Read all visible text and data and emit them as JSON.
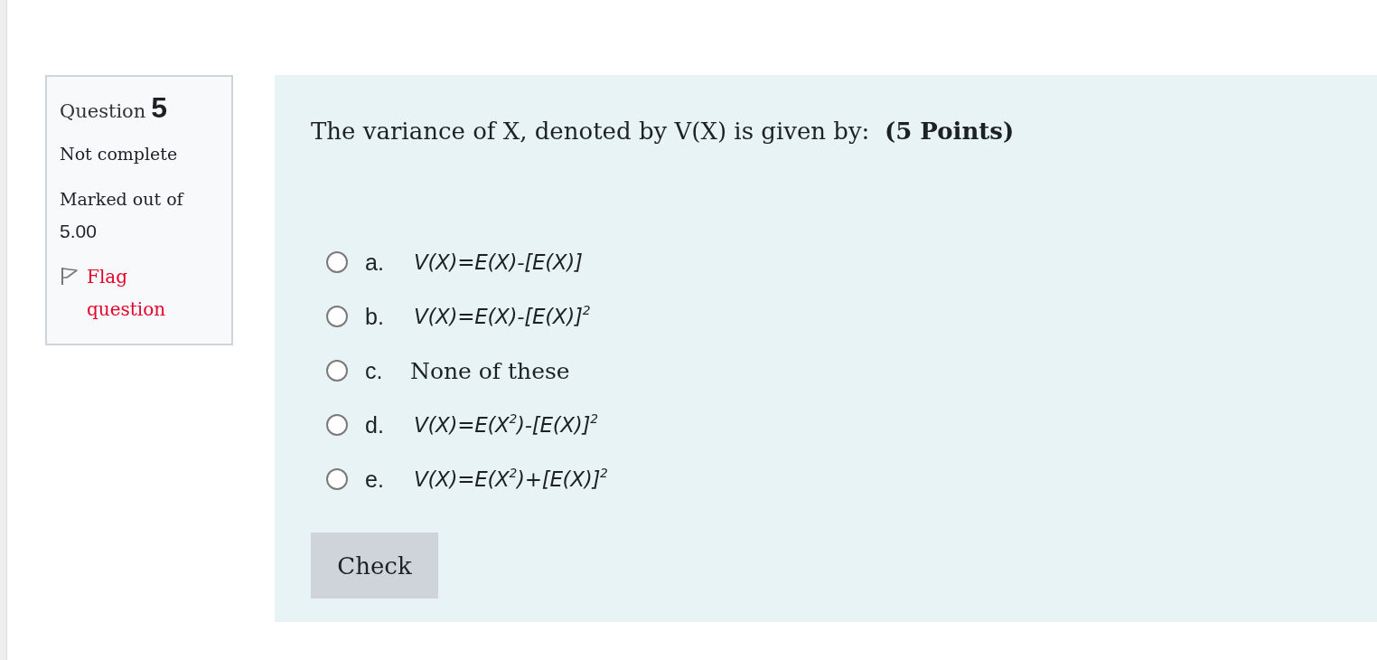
{
  "question_info": {
    "label": "Question",
    "number": "5",
    "status": "Not complete",
    "marks_label": "Marked out of",
    "marks_value": "5.00",
    "flag": {
      "label": "Flag question",
      "flagged": false
    }
  },
  "question": {
    "text": "The variance of X, denoted by V(X) is given by:  **(5 Points)**",
    "options": [
      {
        "letter": "a.",
        "text": "V(X)=E(X)-[E(X)]",
        "kind": "formula",
        "selected": false
      },
      {
        "letter": "b.",
        "text": "V(X)=E(X)-[E(X)]$^{2}$",
        "kind": "formula",
        "selected": false
      },
      {
        "letter": "c.",
        "text": "None of these",
        "kind": "text",
        "selected": false
      },
      {
        "letter": "d.",
        "text": "V(X)=E(X$^{2}$)-[E(X)]$^{2}$",
        "kind": "formula",
        "selected": false
      },
      {
        "letter": "e.",
        "text": "V(X)=E(X$^{2}$)+[E(X)]$^{2}$",
        "kind": "formula",
        "selected": false
      }
    ]
  },
  "check_button": "Check"
}
